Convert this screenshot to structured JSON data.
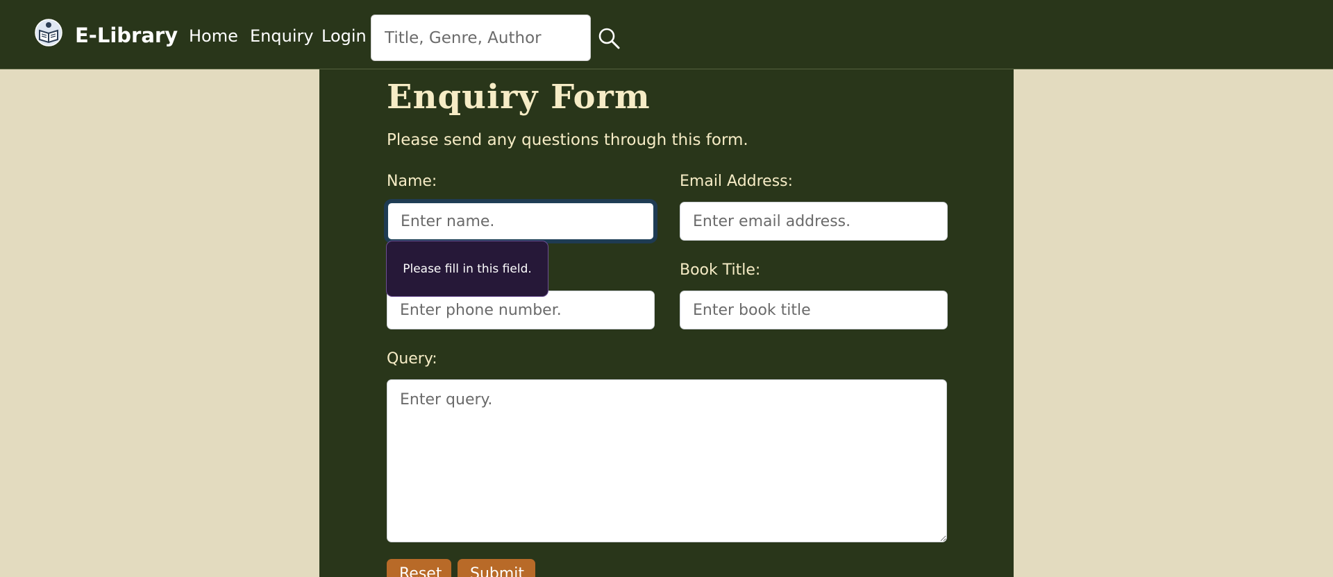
{
  "brand": {
    "name": "E-Library",
    "logo_icon": "book-reader-icon"
  },
  "nav": {
    "links": [
      "Home",
      "Enquiry",
      "Login"
    ]
  },
  "search": {
    "placeholder": "Title, Genre, Author",
    "button_icon": "search-icon"
  },
  "form": {
    "title": "Enquiry Form",
    "intro": "Please send any questions through this form.",
    "name": {
      "label": "Name:",
      "placeholder": "Enter name."
    },
    "email": {
      "label": "Email Address:",
      "placeholder": "Enter email address."
    },
    "phone": {
      "placeholder": "Enter phone number."
    },
    "book": {
      "label": "Book Title:",
      "placeholder": "Enter book title"
    },
    "query": {
      "label": "Query:",
      "placeholder": "Enter query."
    },
    "buttons": {
      "reset": "Reset",
      "submit": "Submit"
    }
  },
  "validation": {
    "message": "Please fill in this field."
  },
  "colors": {
    "navbar": "#29361a",
    "page_background": "#e3dbbf",
    "heading_text": "#f6ecc6",
    "button": "#b86a28",
    "tooltip": "#261838"
  }
}
